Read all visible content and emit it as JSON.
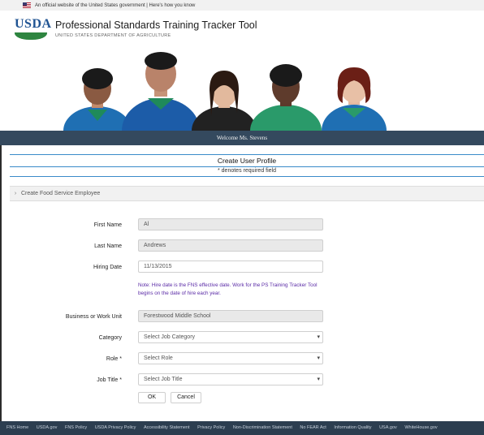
{
  "gov_banner": {
    "text": "An official website of the United States government | Here's how you know"
  },
  "header": {
    "logo_text": "USDA",
    "title": "Professional Standards Training Tracker Tool",
    "subtitle": "UNITED STATES DEPARTMENT OF AGRICULTURE"
  },
  "nav": {
    "welcome": "Welcome Ms. Stevens"
  },
  "page": {
    "title": "Create User Profile",
    "required_note": "* denotes required field",
    "section_label": "Create Food Service Employee"
  },
  "form": {
    "first_name": {
      "label": "First Name",
      "value": "Al"
    },
    "last_name": {
      "label": "Last Name",
      "value": "Andrews"
    },
    "hire_date": {
      "label": "Hiring Date",
      "value": "11/13/2015"
    },
    "hint": "Note: Hire date is the FNS effective date. Work for the PS Training Tracker Tool begins on the date of hire each year.",
    "business_org": {
      "label": "Business or Work Unit",
      "value": "Forestwood Middle School"
    },
    "category": {
      "label": "Category",
      "value": "Select Job Category"
    },
    "role": {
      "label": "Role *",
      "value": "Select Role"
    },
    "job_title": {
      "label": "Job Title *",
      "value": "Select Job Title"
    },
    "ok_label": "OK",
    "cancel_label": "Cancel"
  },
  "footer": {
    "links": [
      "FNS Home",
      "USDA.gov",
      "FNS Policy",
      "USDA Privacy Policy",
      "Accessibility Statement",
      "Privacy Policy",
      "Non-Discrimination Statement",
      "No FEAR Act",
      "Information Quality",
      "USA.gov",
      "WhiteHouse.gov"
    ]
  },
  "colors": {
    "nav_bar": "#34495e",
    "accent_line": "#3a8bc9",
    "usda_blue": "#205493",
    "usda_green": "#2e8540",
    "footer": "#2c3e50"
  }
}
